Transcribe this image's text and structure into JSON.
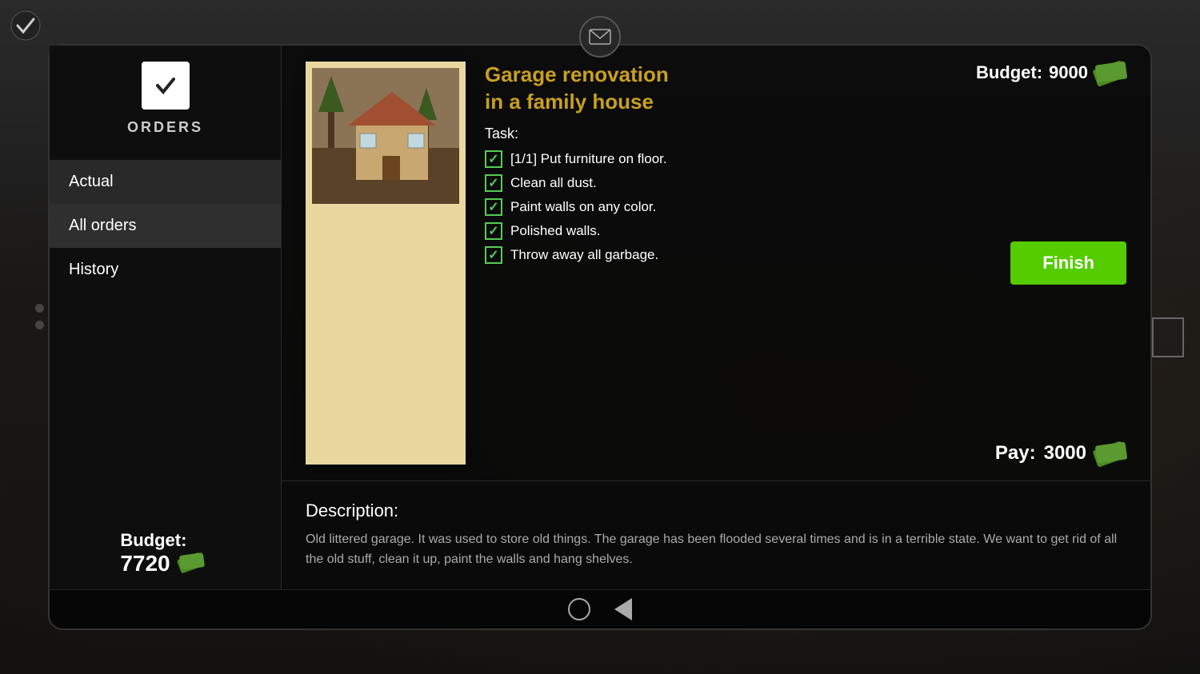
{
  "app": {
    "title": "Orders"
  },
  "topCheck": {
    "symbol": "✓"
  },
  "sidebar": {
    "icon_symbol": "✓",
    "orders_label": "ORDERS",
    "nav_items": [
      {
        "id": "actual",
        "label": "Actual",
        "state": "active"
      },
      {
        "id": "all_orders",
        "label": "All orders",
        "state": "selected"
      },
      {
        "id": "history",
        "label": "History",
        "state": "normal"
      }
    ],
    "budget_label": "Budget:",
    "budget_amount": "7720"
  },
  "order": {
    "title_line1": "Garage renovation",
    "title_line2": "in a family house",
    "task_label": "Task:",
    "tasks": [
      {
        "id": 1,
        "text": "[1/1] Put furniture on floor.",
        "done": true
      },
      {
        "id": 2,
        "text": "Clean all dust.",
        "done": true
      },
      {
        "id": 3,
        "text": "Paint walls on any color.",
        "done": true
      },
      {
        "id": 4,
        "text": "Polished walls.",
        "done": true
      },
      {
        "id": 5,
        "text": "Throw away all garbage.",
        "done": true
      }
    ],
    "budget_label": "Budget:",
    "budget_amount": "9000",
    "pay_label": "Pay:",
    "pay_amount": "3000",
    "finish_button": "Finish"
  },
  "description": {
    "label": "Description:",
    "text": "Old littered garage. It was used to store old things. The garage has been flooded several times and is in a terrible state. We want to get rid of all the old stuff, clean it up, paint the walls and hang shelves."
  },
  "navbar": {
    "circle_title": "home",
    "back_title": "back"
  },
  "colors": {
    "accent_gold": "#c8a020",
    "accent_green": "#55cc00",
    "check_green": "#55cc55",
    "money_green": "#5a9a30"
  }
}
